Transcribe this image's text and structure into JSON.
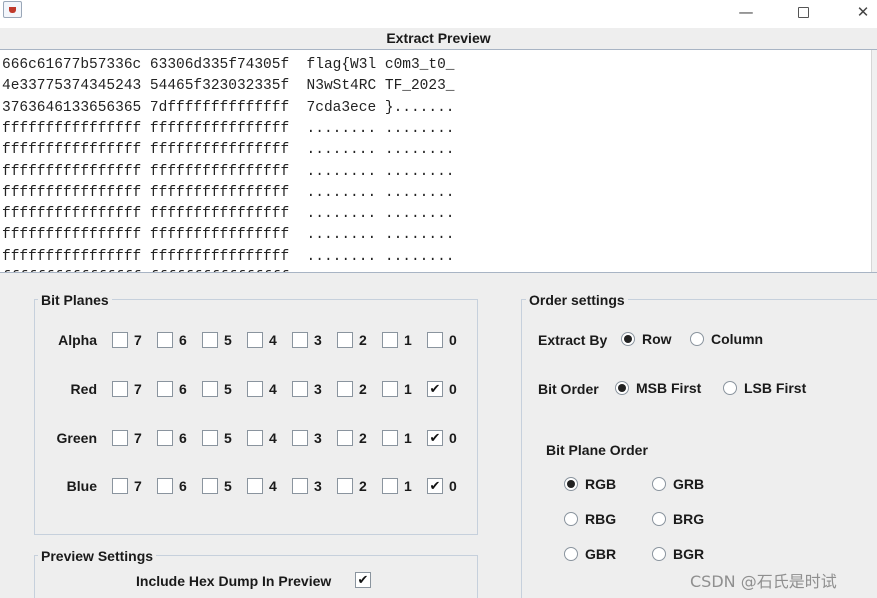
{
  "window": {
    "app_icon": "java-cup-icon",
    "controls": {
      "minimize": "—",
      "close": "✕"
    }
  },
  "preview": {
    "title": "Extract Preview",
    "lines": [
      "666c61677b57336c 63306d335f74305f  flag{W3l c0m3_t0_",
      "4e33775374345243 54465f323032335f  N3wSt4RC TF_2023_",
      "3763646133656365 7dffffffffffffff  7cda3ece }.......",
      "ffffffffffffffff ffffffffffffffff  ........ ........",
      "ffffffffffffffff ffffffffffffffff  ........ ........",
      "ffffffffffffffff ffffffffffffffff  ........ ........",
      "ffffffffffffffff ffffffffffffffff  ........ ........",
      "ffffffffffffffff ffffffffffffffff  ........ ........",
      "ffffffffffffffff ffffffffffffffff  ........ ........",
      "ffffffffffffffff ffffffffffffffff  ........ ........",
      "ffffffffffffffff ffffffffffffffff  ........ ........"
    ]
  },
  "bit_planes": {
    "title": "Bit Planes",
    "bit_labels": [
      "7",
      "6",
      "5",
      "4",
      "3",
      "2",
      "1",
      "0"
    ],
    "rows": [
      {
        "name": "Alpha",
        "checked": [
          false,
          false,
          false,
          false,
          false,
          false,
          false,
          false
        ]
      },
      {
        "name": "Red",
        "checked": [
          false,
          false,
          false,
          false,
          false,
          false,
          false,
          true
        ]
      },
      {
        "name": "Green",
        "checked": [
          false,
          false,
          false,
          false,
          false,
          false,
          false,
          true
        ]
      },
      {
        "name": "Blue",
        "checked": [
          false,
          false,
          false,
          false,
          false,
          false,
          false,
          true
        ]
      }
    ]
  },
  "preview_settings": {
    "title": "Preview Settings",
    "hex_dump_label": "Include Hex Dump In Preview",
    "hex_dump_checked": true
  },
  "order_settings": {
    "title": "Order settings",
    "extract_by_label": "Extract By",
    "extract_by_options": [
      {
        "label": "Row",
        "selected": true
      },
      {
        "label": "Column",
        "selected": false
      }
    ],
    "bit_order_label": "Bit Order",
    "bit_order_options": [
      {
        "label": "MSB First",
        "selected": true
      },
      {
        "label": "LSB First",
        "selected": false
      }
    ],
    "plane_order_label": "Bit Plane Order",
    "plane_order_options": [
      {
        "label": "RGB",
        "selected": true
      },
      {
        "label": "GRB",
        "selected": false
      },
      {
        "label": "RBG",
        "selected": false
      },
      {
        "label": "BRG",
        "selected": false
      },
      {
        "label": "GBR",
        "selected": false
      },
      {
        "label": "BGR",
        "selected": false
      }
    ]
  },
  "watermark": "CSDN @石氏是时试"
}
